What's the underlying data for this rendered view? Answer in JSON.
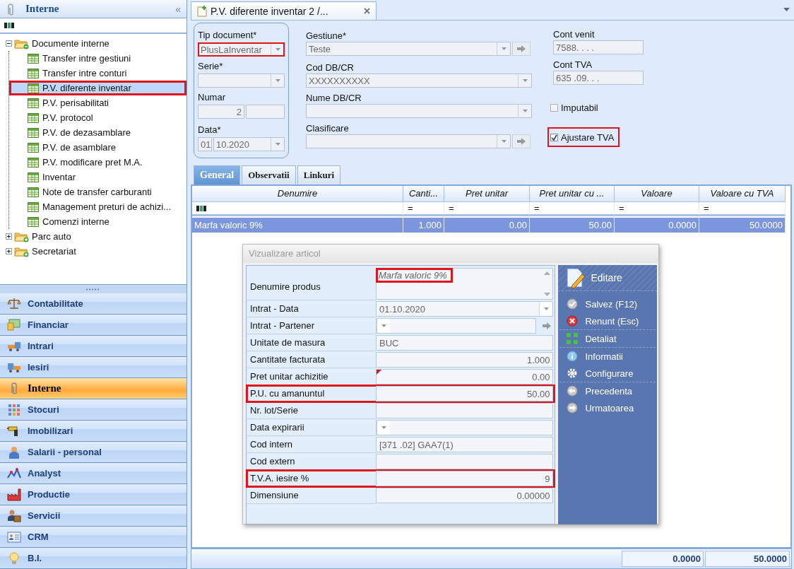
{
  "sidebar": {
    "title": "Interne",
    "collapse_glyph": "«",
    "tree": [
      {
        "label": "Documente interne",
        "expanded": true,
        "children": [
          {
            "label": "Transfer intre gestiuni",
            "selected": false
          },
          {
            "label": "Transfer intre conturi",
            "selected": false
          },
          {
            "label": "P.V. diferente inventar",
            "selected": true
          },
          {
            "label": "P.V. perisabilitati",
            "selected": false
          },
          {
            "label": "P.V. protocol",
            "selected": false
          },
          {
            "label": "P.V. de dezasamblare",
            "selected": false
          },
          {
            "label": "P.V. de asamblare",
            "selected": false
          },
          {
            "label": "P.V. modificare pret M.A.",
            "selected": false
          },
          {
            "label": "Inventar",
            "selected": false
          },
          {
            "label": "Note de transfer carburanti",
            "selected": false
          },
          {
            "label": "Management preturi de achizi...",
            "selected": false
          },
          {
            "label": "Comenzi interne",
            "selected": false
          }
        ]
      },
      {
        "label": "Parc auto",
        "expanded": false
      },
      {
        "label": "Secretariat",
        "expanded": false
      }
    ],
    "nav": [
      {
        "label": "Contabilitate",
        "selected": false
      },
      {
        "label": "Financiar",
        "selected": false
      },
      {
        "label": "Intrari",
        "selected": false
      },
      {
        "label": "Iesiri",
        "selected": false
      },
      {
        "label": "Interne",
        "selected": true
      },
      {
        "label": "Stocuri",
        "selected": false
      },
      {
        "label": "Imobilizari",
        "selected": false
      },
      {
        "label": "Salarii - personal",
        "selected": false
      },
      {
        "label": "Analyst",
        "selected": false
      },
      {
        "label": "Productie",
        "selected": false
      },
      {
        "label": "Servicii",
        "selected": false
      },
      {
        "label": "CRM",
        "selected": false
      },
      {
        "label": "B.I.",
        "selected": false
      }
    ]
  },
  "document_tab": {
    "title": "P.V. diferente inventar 2 /..."
  },
  "form": {
    "columns": [
      [
        {
          "label": "Tip document*",
          "kind": "combo",
          "value": "PlusLaInventar",
          "highlighted": true
        },
        {
          "label": "Serie*",
          "kind": "combo",
          "highlighted": false
        },
        {
          "label": "Numar",
          "kind": "pair",
          "value": "2",
          "highlighted": false
        },
        {
          "label": "Data*",
          "kind": "date",
          "parts": [
            "01",
            "10.2020"
          ],
          "highlighted": false
        }
      ],
      [
        {
          "label": "Gestiune*",
          "kind": "combo_link",
          "value": "Teste",
          "highlighted": false
        },
        {
          "label": "Cod DB/CR",
          "kind": "combo",
          "value": "XXXXXXXXXX",
          "highlighted": false
        },
        {
          "label": "Nume DB/CR",
          "kind": "combo",
          "highlighted": false
        },
        {
          "label": "Clasificare",
          "kind": "combo_link",
          "highlighted": false
        }
      ],
      [
        {
          "label": "Cont venit",
          "kind": "text",
          "value": "7588. . . .",
          "highlighted": false
        },
        {
          "label": "Cont TVA",
          "kind": "text",
          "value": "635 .09. . .",
          "highlighted": false
        },
        {
          "label": "Imputabil",
          "kind": "checkbox",
          "checked": false,
          "highlighted": false
        },
        {
          "label": "Ajustare TVA",
          "kind": "checkbox",
          "checked": true,
          "highlighted": true
        }
      ]
    ]
  },
  "tabs": [
    {
      "label": "General",
      "selected": true
    },
    {
      "label": "Observatii",
      "selected": false
    },
    {
      "label": "Linkuri",
      "selected": false
    }
  ],
  "grid": {
    "columns": [
      {
        "label": "Denumire"
      },
      {
        "label": "Canti...",
        "filter_glyph": "="
      },
      {
        "label": "Pret unitar",
        "filter_glyph": "="
      },
      {
        "label": "Pret unitar cu ...",
        "filter_glyph": "="
      },
      {
        "label": "Valoare",
        "filter_glyph": "="
      },
      {
        "label": "Valoare cu TVA",
        "filter_glyph": "="
      }
    ],
    "rows": [
      {
        "cells": [
          "Marfa valoric 9%",
          "1.000",
          "0.00",
          "50.00",
          "0.0000",
          "50.0000"
        ],
        "selected": true
      }
    ],
    "totals": [
      "0.0000",
      "50.0000"
    ]
  },
  "dialog": {
    "title": "Vizualizare articol",
    "rows": [
      {
        "label": "Denumire produs",
        "kind": "memo",
        "value": "Marfa valoric 9%",
        "highlighted": true,
        "flagged": false
      },
      {
        "label": "Intrat - Data",
        "kind": "combo",
        "value": "01.10.2020",
        "highlighted": false,
        "flagged": false
      },
      {
        "label": "Intrat - Partener",
        "kind": "combo_link",
        "highlighted": false,
        "flagged": false
      },
      {
        "label": "Unitate de masura",
        "kind": "text",
        "value": "BUC",
        "highlighted": false,
        "flagged": false
      },
      {
        "label": "Cantitate facturata",
        "kind": "number",
        "value": "1.000",
        "highlighted": false,
        "flagged": false
      },
      {
        "label": "Pret unitar achizitie",
        "kind": "number",
        "value": "0.00",
        "highlighted": false,
        "flagged": true
      },
      {
        "label": "P.U. cu amanuntul",
        "kind": "number",
        "value": "50.00",
        "highlighted": true,
        "flagged": false
      },
      {
        "label": "Nr. lot/Serie",
        "kind": "text",
        "highlighted": false,
        "flagged": false
      },
      {
        "label": "Data expirarii",
        "kind": "combo",
        "highlighted": false,
        "flagged": false
      },
      {
        "label": "Cod intern",
        "kind": "text",
        "value": "[371 .02] GAA7(1)",
        "highlighted": false,
        "flagged": false
      },
      {
        "label": "Cod extern",
        "kind": "text",
        "highlighted": false,
        "flagged": false
      },
      {
        "label": "T.V.A. iesire %",
        "kind": "number",
        "value": "9",
        "highlighted": true,
        "flagged": false
      },
      {
        "label": "Dimensiune",
        "kind": "number",
        "value": "0.00000",
        "highlighted": false,
        "flagged": false
      }
    ],
    "actions": [
      {
        "label": "Editare",
        "kind": "header",
        "divider": true
      },
      {
        "label": "Salvez (F12)",
        "kind": "item",
        "divider": false
      },
      {
        "label": "Renunt (Esc)",
        "kind": "item",
        "divider": true
      },
      {
        "label": "Detaliat",
        "kind": "item",
        "divider": true
      },
      {
        "label": "Informatii",
        "kind": "item",
        "divider": false
      },
      {
        "label": "Configurare",
        "kind": "item",
        "divider": true
      },
      {
        "label": "Precedenta",
        "kind": "item",
        "divider": false
      },
      {
        "label": "Urmatoarea",
        "kind": "item",
        "divider": false
      }
    ]
  }
}
